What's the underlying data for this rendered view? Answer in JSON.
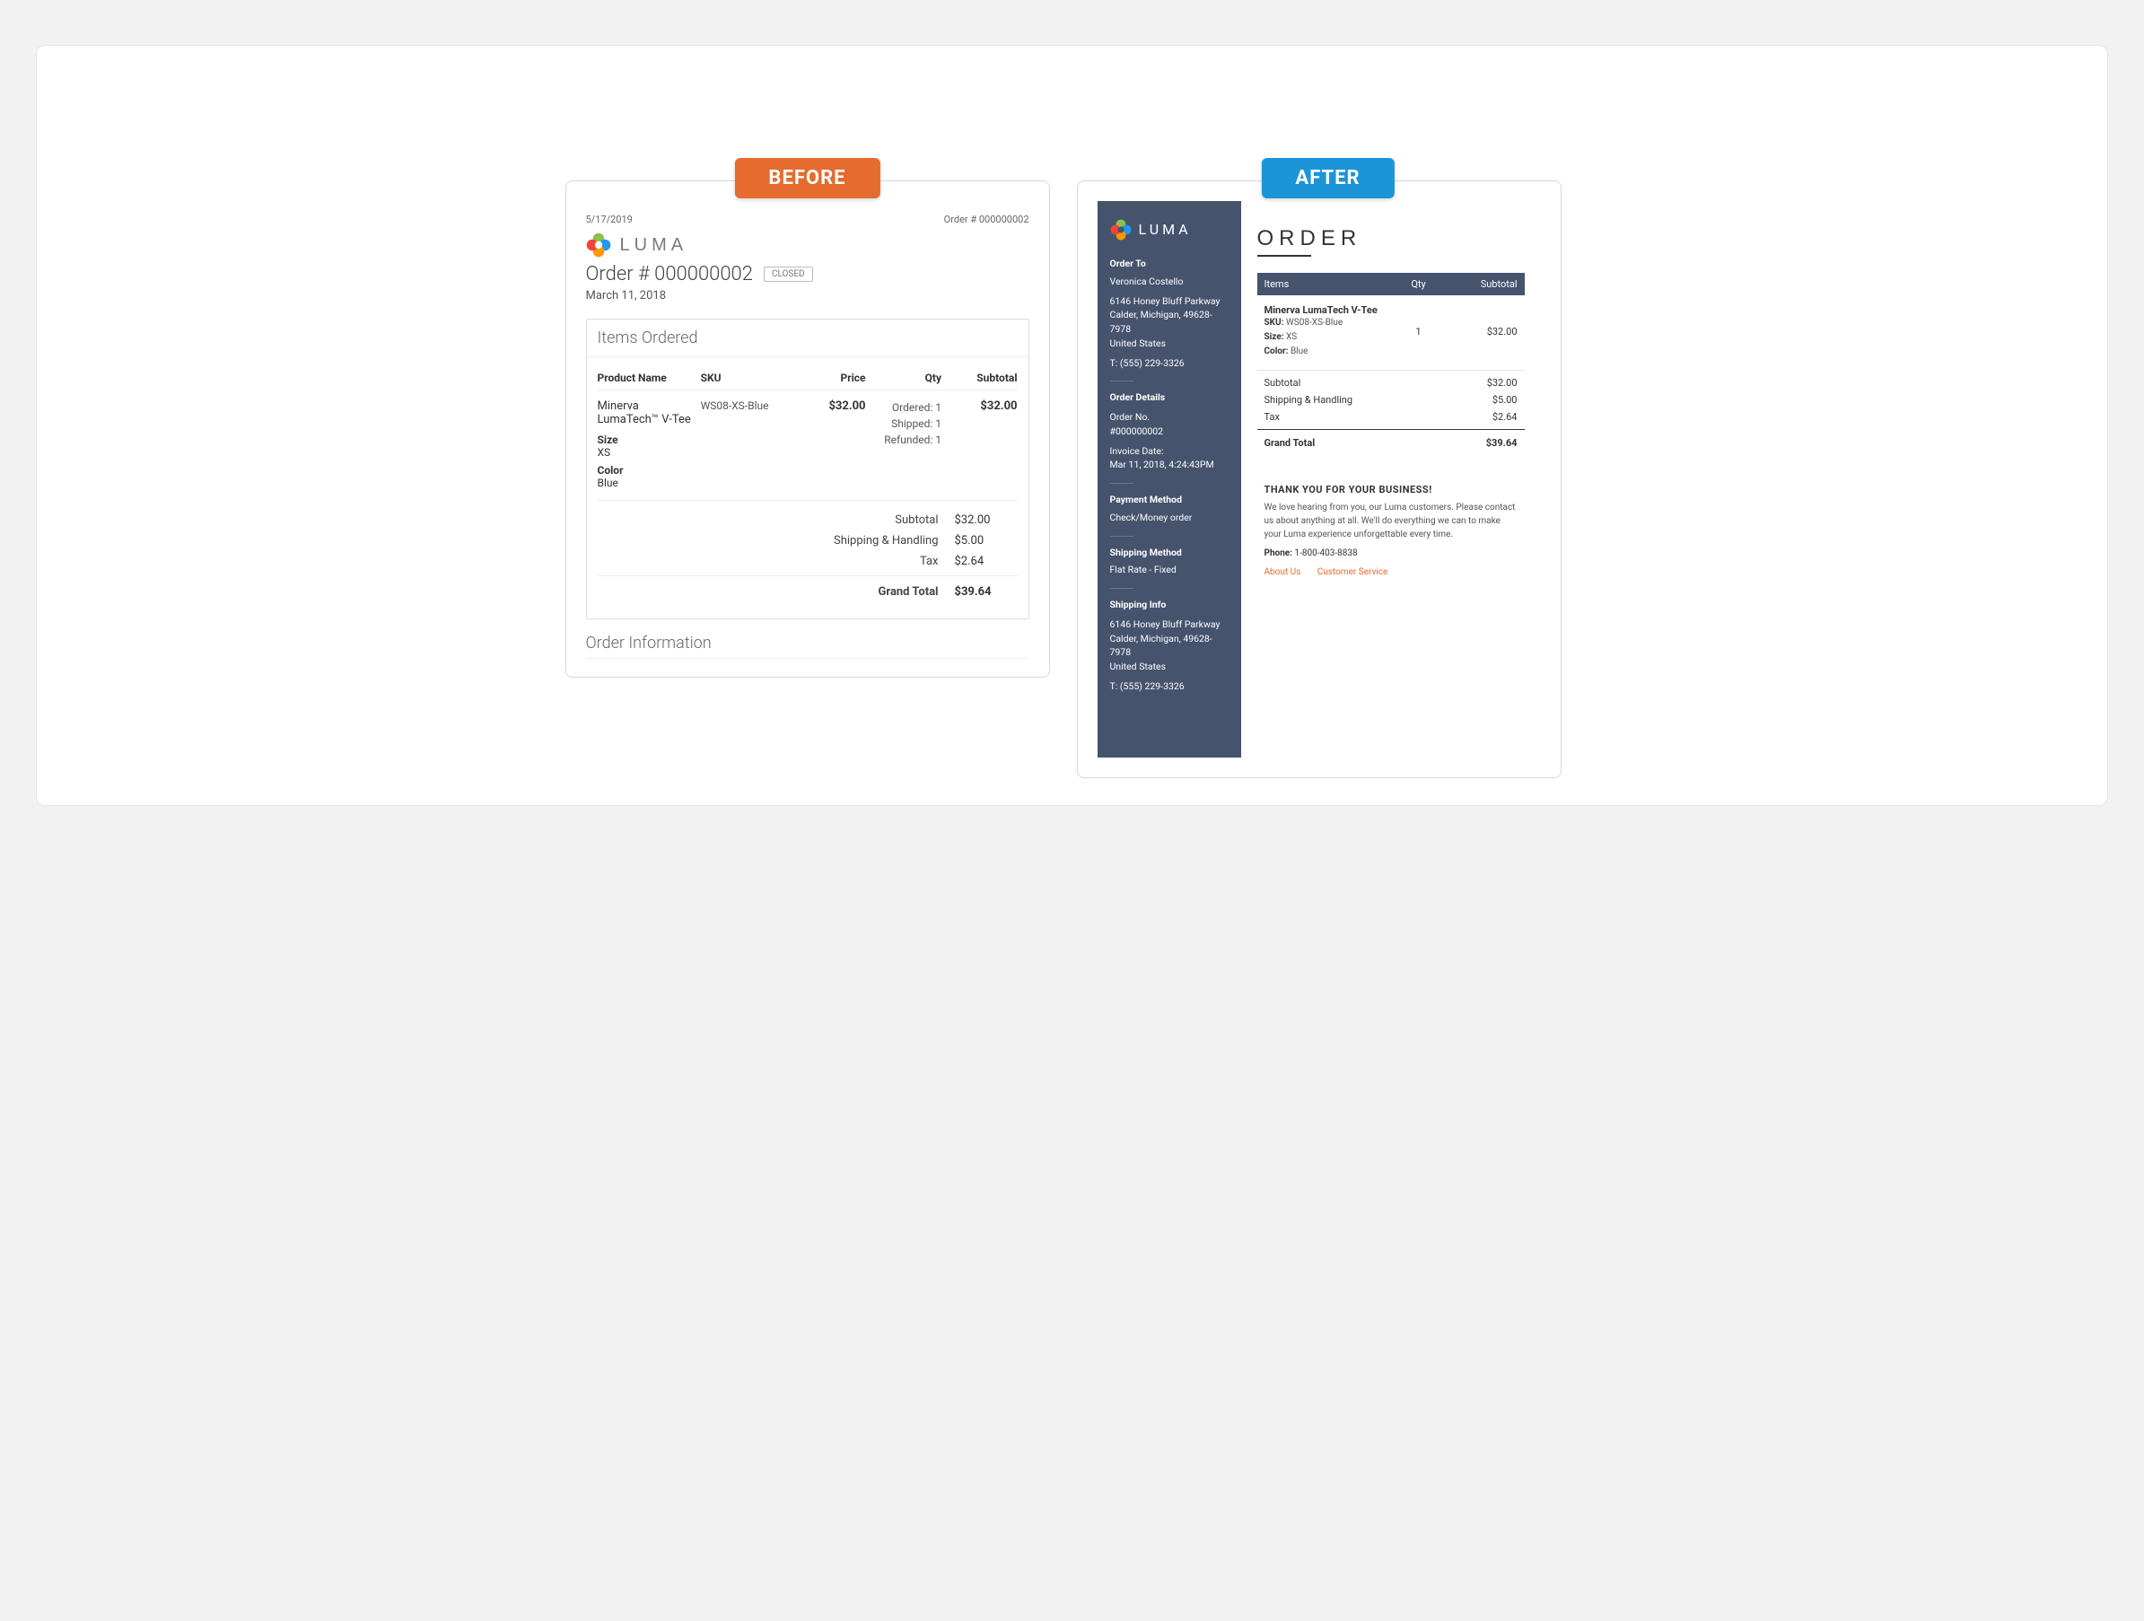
{
  "badges": {
    "before": "BEFORE",
    "after": "AFTER"
  },
  "brand": "LUMA",
  "before": {
    "top_date": "5/17/2019",
    "top_order": "Order # 000000002",
    "order_label": "Order # 000000002",
    "status": "CLOSED",
    "date": "March 11, 2018",
    "items_title": "Items Ordered",
    "headers": {
      "name": "Product Name",
      "sku": "SKU",
      "price": "Price",
      "qty": "Qty",
      "subtotal": "Subtotal"
    },
    "item": {
      "name": "Minerva LumaTech™ V-Tee",
      "sku": "WS08-XS-Blue",
      "price": "$32.00",
      "qty_ordered_label": "Ordered:",
      "qty_ordered_val": "1",
      "qty_shipped_label": "Shipped:",
      "qty_shipped_val": "1",
      "qty_refunded_label": "Refunded:",
      "qty_refunded_val": "1",
      "subtotal": "$32.00",
      "size_label": "Size",
      "size_val": "XS",
      "color_label": "Color",
      "color_val": "Blue"
    },
    "totals": {
      "subtotal_label": "Subtotal",
      "subtotal_val": "$32.00",
      "ship_label": "Shipping & Handling",
      "ship_val": "$5.00",
      "tax_label": "Tax",
      "tax_val": "$2.64",
      "grand_label": "Grand Total",
      "grand_val": "$39.64"
    },
    "info_heading": "Order Information"
  },
  "after": {
    "title": "ORDER",
    "side": {
      "order_to_label": "Order To",
      "order_to_name": "Veronica Costello",
      "addr_line1": "6146 Honey Bluff Parkway",
      "addr_line2": "Calder, Michigan, 49628-7978",
      "addr_country": "United States",
      "tel_label": "T:",
      "tel_val": "(555) 229-3326",
      "details_label": "Order Details",
      "orderno_label": "Order No.",
      "orderno_val": "#000000002",
      "invoice_date_label": "Invoice Date:",
      "invoice_date_val": "Mar 11, 2018, 4:24:43PM",
      "payment_label": "Payment Method",
      "payment_val": "Check/Money order",
      "ship_method_label": "Shipping Method",
      "ship_method_val": "Flat Rate - Fixed",
      "ship_info_label": "Shipping Info",
      "ship_addr_line1": "6146 Honey Bluff Parkway",
      "ship_addr_line2": "Calder, Michigan, 49628-7978",
      "ship_addr_country": "United States",
      "ship_tel_label": "T:",
      "ship_tel_val": "(555) 229-3326"
    },
    "thead": {
      "items": "Items",
      "qty": "Qty",
      "subtotal": "Subtotal"
    },
    "row": {
      "name": "Minerva LumaTech V-Tee",
      "sku_label": "SKU:",
      "sku": "WS08-XS-Blue",
      "size_label": "Size:",
      "size": "XS",
      "color_label": "Color:",
      "color": "Blue",
      "qty": "1",
      "subtotal": "$32.00"
    },
    "totals": {
      "subtotal_label": "Subtotal",
      "subtotal_val": "$32.00",
      "ship_label": "Shipping & Handling",
      "ship_val": "$5.00",
      "tax_label": "Tax",
      "tax_val": "$2.64",
      "grand_label": "Grand Total",
      "grand_val": "$39.64"
    },
    "thanks": "THANK YOU FOR YOUR BUSINESS!",
    "message": "We love hearing from you, our Luma customers. Please contact us about anything at all. We'll do everything we can to make your Luma experience unforgettable every time.",
    "phone_label": "Phone:",
    "phone_val": "1-800-403-8838",
    "links": {
      "about": "About Us",
      "cs": "Customer Service"
    }
  }
}
